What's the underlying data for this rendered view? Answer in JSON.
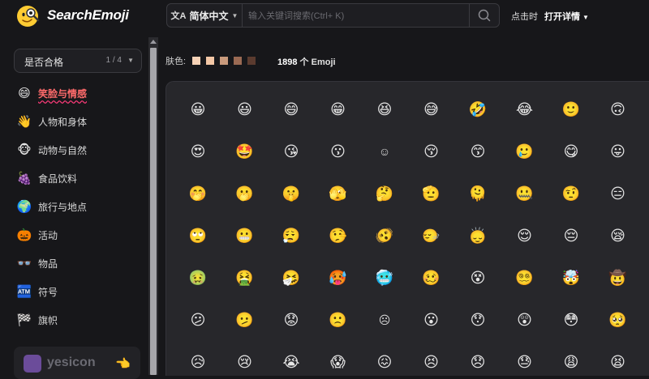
{
  "app": {
    "name": "SearchEmoji"
  },
  "header": {
    "language_label": "简体中文",
    "search_placeholder": "输入关键词搜索(Ctrl+ K)",
    "click_label": "点击时",
    "click_action": "打开详情"
  },
  "sidebar": {
    "filter": {
      "label": "是否合格",
      "count": "1 / 4"
    },
    "categories": [
      {
        "label": "笑脸与情感",
        "icon": "😄",
        "icon_name": "smile-icon",
        "active": true
      },
      {
        "label": "人物和身体",
        "icon": "👋",
        "icon_name": "waving-hand-icon",
        "active": false
      },
      {
        "label": "动物与自然",
        "icon": "🐵",
        "icon_name": "monkey-icon",
        "active": false
      },
      {
        "label": "食品饮料",
        "icon": "🍇",
        "icon_name": "grapes-icon",
        "active": false
      },
      {
        "label": "旅行与地点",
        "icon": "🌍",
        "icon_name": "globe-icon",
        "active": false
      },
      {
        "label": "活动",
        "icon": "🎃",
        "icon_name": "pumpkin-icon",
        "active": false
      },
      {
        "label": "物品",
        "icon": "👓",
        "icon_name": "glasses-icon",
        "active": false
      },
      {
        "label": "符号",
        "icon": "🏧",
        "icon_name": "atm-icon",
        "active": false
      },
      {
        "label": "旗帜",
        "icon": "🏁",
        "icon_name": "checkered-flag-icon",
        "active": false
      }
    ],
    "promo": {
      "text": "yesicon"
    }
  },
  "main": {
    "skin_label": "肤色:",
    "skin_tones": [
      "#f6d2b6",
      "#f3c7a6",
      "#c99a7c",
      "#9a6a53",
      "#5b3b2f"
    ],
    "emoji_count": "1898",
    "emoji_count_suffix": "个 Emoji",
    "emojis": [
      [
        "😀",
        "😃",
        "😄",
        "😁",
        "😆",
        "😅",
        "🤣",
        "😂",
        "🙂",
        "🙃"
      ],
      [
        "😍",
        "🤩",
        "😘",
        "😗",
        "☺",
        "😚",
        "😙",
        "🥲",
        "😋",
        "😛"
      ],
      [
        "🤭",
        "🫢",
        "🤫",
        "🫣",
        "🤔",
        "🫡",
        "🫠",
        "🤐",
        "🤨",
        "😑"
      ],
      [
        "🙄",
        "😬",
        "😮‍💨",
        "🤥",
        "🫨",
        "🙂‍↔️",
        "🙂‍↕️",
        "😌",
        "😔",
        "😪"
      ],
      [
        "🤢",
        "🤮",
        "🤧",
        "🥵",
        "🥶",
        "🥴",
        "😵",
        "😵‍💫",
        "🤯",
        "🤠"
      ],
      [
        "😕",
        "🫤",
        "😟",
        "🙁",
        "☹",
        "😮",
        "😯",
        "😲",
        "😳",
        "🥺"
      ],
      [
        "😥",
        "😢",
        "😭",
        "😱",
        "😖",
        "😣",
        "😞",
        "😓",
        "😩",
        "😫"
      ]
    ]
  },
  "colors": {
    "accent": "#ff6b6b",
    "background": "#17171a",
    "panel": "#27272b"
  }
}
